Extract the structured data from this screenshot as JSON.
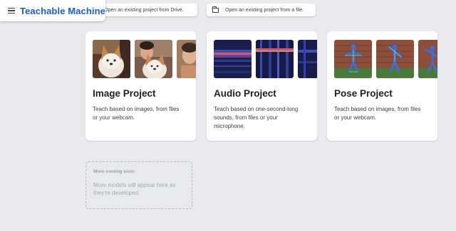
{
  "header": {
    "app_title": "Teachable Machine",
    "menu_icon": "hamburger-menu-icon"
  },
  "actions": {
    "open_drive_label": "Open an existing project from Drive.",
    "open_file_label": "Open an existing project from a file.",
    "open_file_icon": "folder-icon"
  },
  "projects": [
    {
      "title": "Image Project",
      "description": "Teach based on images, from files or your webcam."
    },
    {
      "title": "Audio Project",
      "description": "Teach based on one-second-long sounds, from files or your microphone."
    },
    {
      "title": "Pose Project",
      "description": "Teach based on images, from files or your webcam."
    }
  ],
  "coming_soon": {
    "title": "More coming soon",
    "description": "More models will appear here as they're developed."
  },
  "colors": {
    "background": "#e8eaed",
    "brand_blue": "#1a5cc9",
    "card": "#ffffff"
  }
}
